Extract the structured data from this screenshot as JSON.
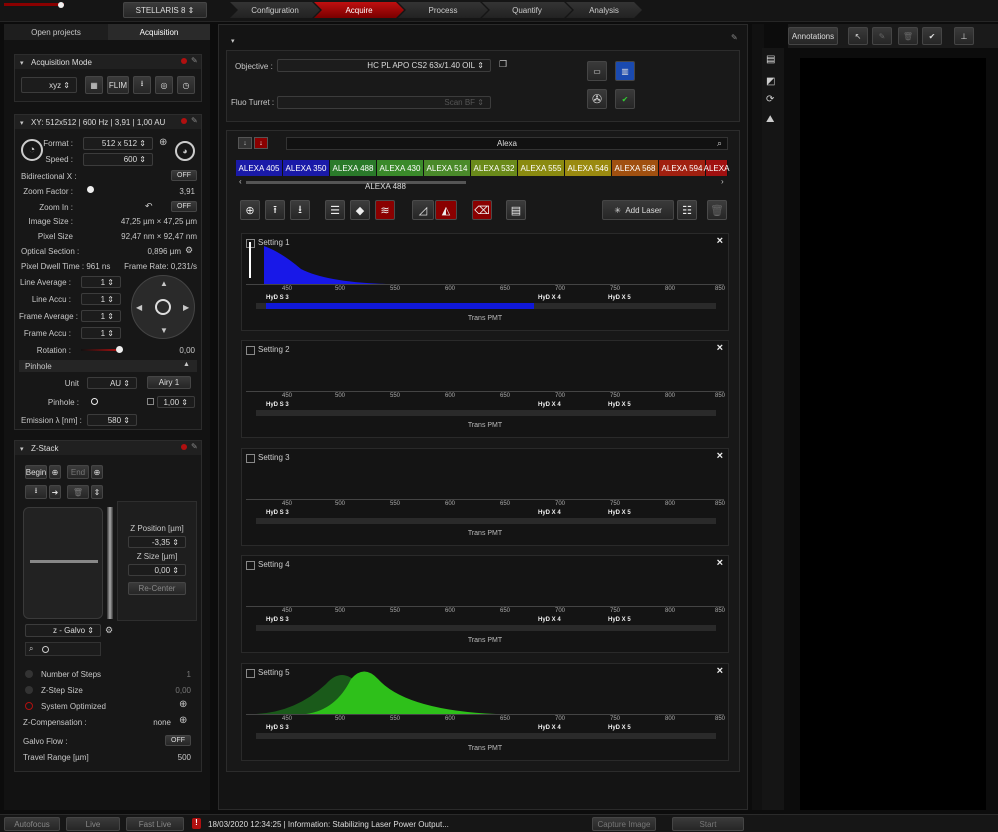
{
  "top": {
    "instrument": "STELLARIS 8",
    "nav": [
      "Configuration",
      "Acquire",
      "Process",
      "Quantify",
      "Analysis"
    ],
    "active_nav": "Acquire"
  },
  "left_tabs": {
    "open_projects": "Open projects",
    "acquisition": "Acquisition"
  },
  "acq_mode": {
    "title": "Acquisition Mode",
    "mode": "xyz",
    "flim": "FLIM"
  },
  "scan": {
    "title": "XY: 512x512 | 600 Hz | 3,91 | 1,00 AU",
    "format_label": "Format :",
    "format": "512 x 512",
    "speed_label": "Speed :",
    "speed": "600",
    "bidir_label": "Bidirectional X :",
    "off": "OFF",
    "zoom_factor_label": "Zoom Factor :",
    "zoom_factor": "3,91",
    "zoom_in_label": "Zoom In :",
    "image_size_label": "Image Size :",
    "image_size": "47,25 µm × 47,25 µm",
    "pixel_size_label": "Pixel Size",
    "pixel_size": "92,47 nm × 92,47 nm",
    "optical_label": "Optical Section :",
    "optical": "0,896 µm",
    "dwell": "Pixel Dwell Time : 961 ns",
    "frame_rate": "Frame Rate: 0,231/s",
    "line_avg_label": "Line Average :",
    "line_accu_label": "Line Accu :",
    "frame_avg_label": "Frame Average :",
    "frame_accu_label": "Frame Accu :",
    "one": "1",
    "rotation_label": "Rotation :",
    "rotation": "0,00",
    "pinhole_head": "Pinhole",
    "unit_label": "Unit",
    "unit": "AU",
    "airy": "Airy 1",
    "pinhole_label": "Pinhole :",
    "pinhole": "1,00",
    "emission_label": "Emission λ [nm] :",
    "emission": "580"
  },
  "zstack": {
    "title": "Z-Stack",
    "begin": "Begin",
    "end": "End",
    "zpos_label": "Z Position [µm]",
    "zpos": "-3,35",
    "zsize_label": "Z Size [µm]",
    "zsize": "0,00",
    "recenter": "Re-Center",
    "galvo": "z - Galvo",
    "steps_label": "Number of Steps",
    "steps": "1",
    "step_size_label": "Z-Step Size",
    "step_size": "0,00",
    "sysopt_label": "System Optimized",
    "zcomp_label": "Z-Compensation :",
    "zcomp": "none",
    "galvo_flow_label": "Galvo Flow :",
    "travel_label": "Travel Range [µm]",
    "travel": "500"
  },
  "objective": {
    "label": "Objective :",
    "value": "HC PL APO CS2   63x/1.40 OIL",
    "fluo_label": "Fluo Turret :",
    "fluo": "Scan BF"
  },
  "dyes": {
    "search": "Alexa",
    "selected": "ALEXA 488",
    "add_laser": "Add Laser",
    "items": [
      {
        "name": "ALEXA 405",
        "color": "#1a1aa8"
      },
      {
        "name": "ALEXA 350",
        "color": "#1a1aa8"
      },
      {
        "name": "ALEXA 488",
        "color": "#2a7a2a"
      },
      {
        "name": "ALEXA 430",
        "color": "#3a8a2a"
      },
      {
        "name": "ALEXA 514",
        "color": "#4a8a2a"
      },
      {
        "name": "ALEXA 532",
        "color": "#6a8a1a"
      },
      {
        "name": "ALEXA 555",
        "color": "#8a8a10"
      },
      {
        "name": "ALEXA 546",
        "color": "#9a8a10"
      },
      {
        "name": "ALEXA 568",
        "color": "#a05010"
      },
      {
        "name": "ALEXA 594",
        "color": "#a02010"
      },
      {
        "name": "ALEXA",
        "color": "#a01010"
      }
    ]
  },
  "settings": [
    {
      "name": "Setting 1"
    },
    {
      "name": "Setting 2"
    },
    {
      "name": "Setting 3"
    },
    {
      "name": "Setting 4"
    },
    {
      "name": "Setting 5"
    }
  ],
  "ticks": [
    "450",
    "500",
    "550",
    "600",
    "650",
    "700",
    "750",
    "800",
    "850"
  ],
  "detectors": {
    "hyd_s3": "HyD S 3",
    "hyd_x4": "HyD X 4",
    "hyd_x5": "HyD X 5",
    "trans": "Trans PMT"
  },
  "right": {
    "annotations": "Annotations"
  },
  "status": {
    "autofocus": "Autofocus",
    "live": "Live",
    "fast_live": "Fast Live",
    "message": "18/03/2020 12:34:25 | Information: Stabilizing Laser Power Output...",
    "capture": "Capture Image",
    "start": "Start"
  }
}
